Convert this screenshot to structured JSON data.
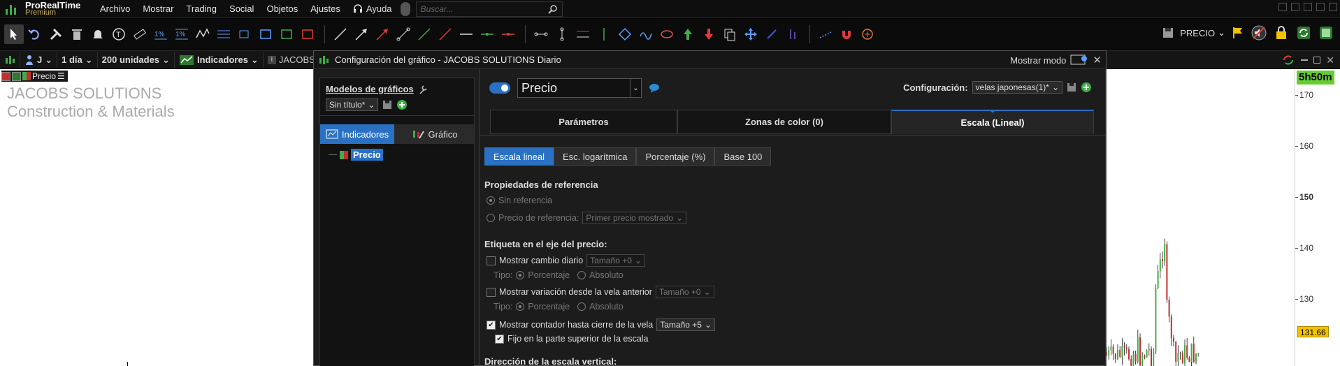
{
  "app": {
    "name": "ProRealTime",
    "edition": "Premium"
  },
  "menu": [
    "Archivo",
    "Mostrar",
    "Trading",
    "Social",
    "Objetos",
    "Ajustes"
  ],
  "help_label": "Ayuda",
  "search": {
    "placeholder": "Buscar..."
  },
  "toolbar_right": {
    "precio_label": "PRECIO"
  },
  "secbar": {
    "symbol_short": "J",
    "period": "1 día",
    "units": "200 unidades",
    "indicators": "Indicadores",
    "chart_tab_label": "JACOBS"
  },
  "chart": {
    "legend_label": "Precio",
    "name_line1": "JACOBS SOLUTIONS",
    "name_line2": "Construction & Materials",
    "countdown": "5h50m",
    "last_price": "131.66",
    "ticks": [
      {
        "label": "170",
        "value": 170,
        "bold": false
      },
      {
        "label": "160",
        "value": 160,
        "bold": false
      },
      {
        "label": "150",
        "value": 150,
        "bold": true
      },
      {
        "label": "140",
        "value": 140,
        "bold": false
      },
      {
        "label": "130",
        "value": 130,
        "bold": false
      }
    ],
    "colors": {
      "up": "#3fae49",
      "down": "#c03030",
      "countdown_bg": "#66cc33",
      "last_price_bg": "#f2c200"
    }
  },
  "dialog": {
    "title": "Configuración del gráfico - JACOBS SOLUTIONS Diario",
    "show_mode": "Mostrar modo",
    "models_title": "Modelos de gráficos",
    "model_selected": "Sin título*",
    "left_tabs": {
      "indicators": "Indicadores",
      "chart": "Gráfico"
    },
    "tree_item": "Precio",
    "main_select": "Precio",
    "config_label": "Configuración:",
    "config_value": "velas japonesas(1)*",
    "tabs": [
      "Parámetros",
      "Zonas de color (0)",
      "Escala (Lineal)"
    ],
    "scale_buttons": [
      "Escala lineal",
      "Esc. logarítmica",
      "Porcentaje (%)",
      "Base 100"
    ],
    "ref_section": "Propiedades de referencia",
    "ref_none": "Sin referencia",
    "ref_price": "Precio de referencia:",
    "ref_price_value": "Primer precio mostrado",
    "label_section": "Etiqueta en el eje del precio:",
    "show_daily_change": "Mostrar cambio diario",
    "size_zero": "Tamaño +0",
    "type_label": "Tipo:",
    "percentage": "Porcentaje",
    "absolute": "Absoluto",
    "show_variation": "Mostrar variación desde la vela anterior",
    "show_countdown": "Mostrar contador hasta cierre de la vela",
    "size_five": "Tamaño +5",
    "fixed_top": "Fijo en la parte superior de la escala",
    "direction_section": "Dirección de la escala vertical:"
  },
  "accent": "#2a71c4"
}
